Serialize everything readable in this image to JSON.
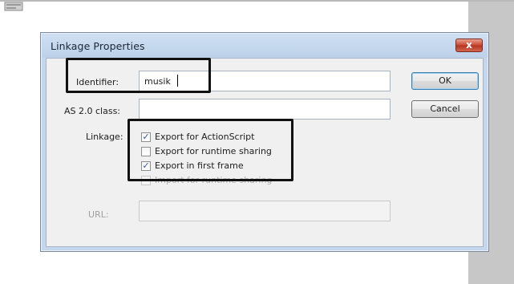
{
  "dialog": {
    "title": "Linkage Properties",
    "close_label": "x"
  },
  "fields": {
    "identifier_label": "Identifier:",
    "identifier_value": "musik",
    "as2_class_label": "AS 2.0 class:",
    "as2_class_value": "",
    "url_label": "URL:",
    "url_value": ""
  },
  "buttons": {
    "ok_label": "OK",
    "cancel_label": "Cancel"
  },
  "linkage": {
    "label": "Linkage:",
    "options": [
      {
        "label": "Export for ActionScript",
        "checked": true,
        "enabled": true
      },
      {
        "label": "Export for runtime sharing",
        "checked": false,
        "enabled": true
      },
      {
        "label": "Export in first frame",
        "checked": true,
        "enabled": true
      },
      {
        "label": "Import for runtime sharing",
        "checked": false,
        "enabled": false
      }
    ]
  },
  "colors": {
    "title_bar": "#bdd2ea",
    "client_area": "#f0f0f0",
    "close_button": "#c8472f",
    "highlight_box": "#111111"
  }
}
